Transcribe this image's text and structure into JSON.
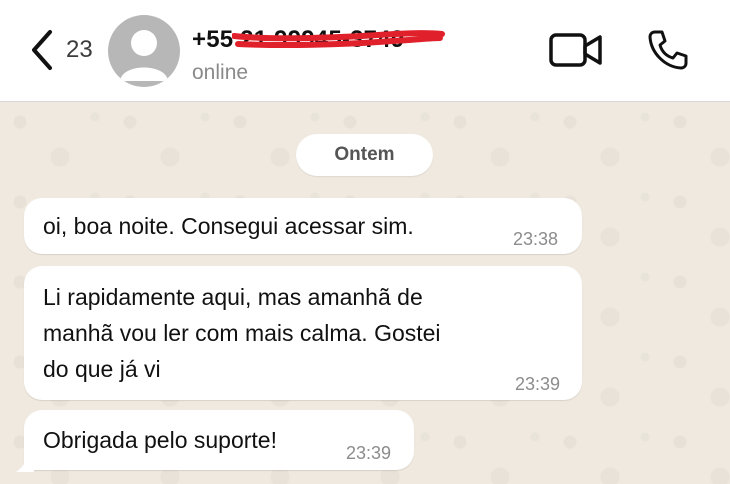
{
  "header": {
    "back_count": "23",
    "contact_name": "+55 21 99945-3749",
    "status": "online"
  },
  "date_chip": "Ontem",
  "messages": [
    {
      "text": "oi, boa noite. Consegui acessar sim.",
      "time": "23:38"
    },
    {
      "lines": [
        "Li rapidamente aqui, mas amanhã de",
        "manhã vou ler com mais calma. Gostei",
        "do que já vi"
      ],
      "time": "23:39"
    },
    {
      "text": "Obrigada pelo suporte!",
      "time": "23:39"
    }
  ],
  "icons": [
    "chevron-left-icon",
    "avatar",
    "video-camera-icon",
    "phone-icon"
  ],
  "colors": {
    "header_bg": "#ffffff",
    "chat_bg": "#efe9df",
    "bubble_bg": "#ffffff",
    "redaction": "#e0202a"
  }
}
